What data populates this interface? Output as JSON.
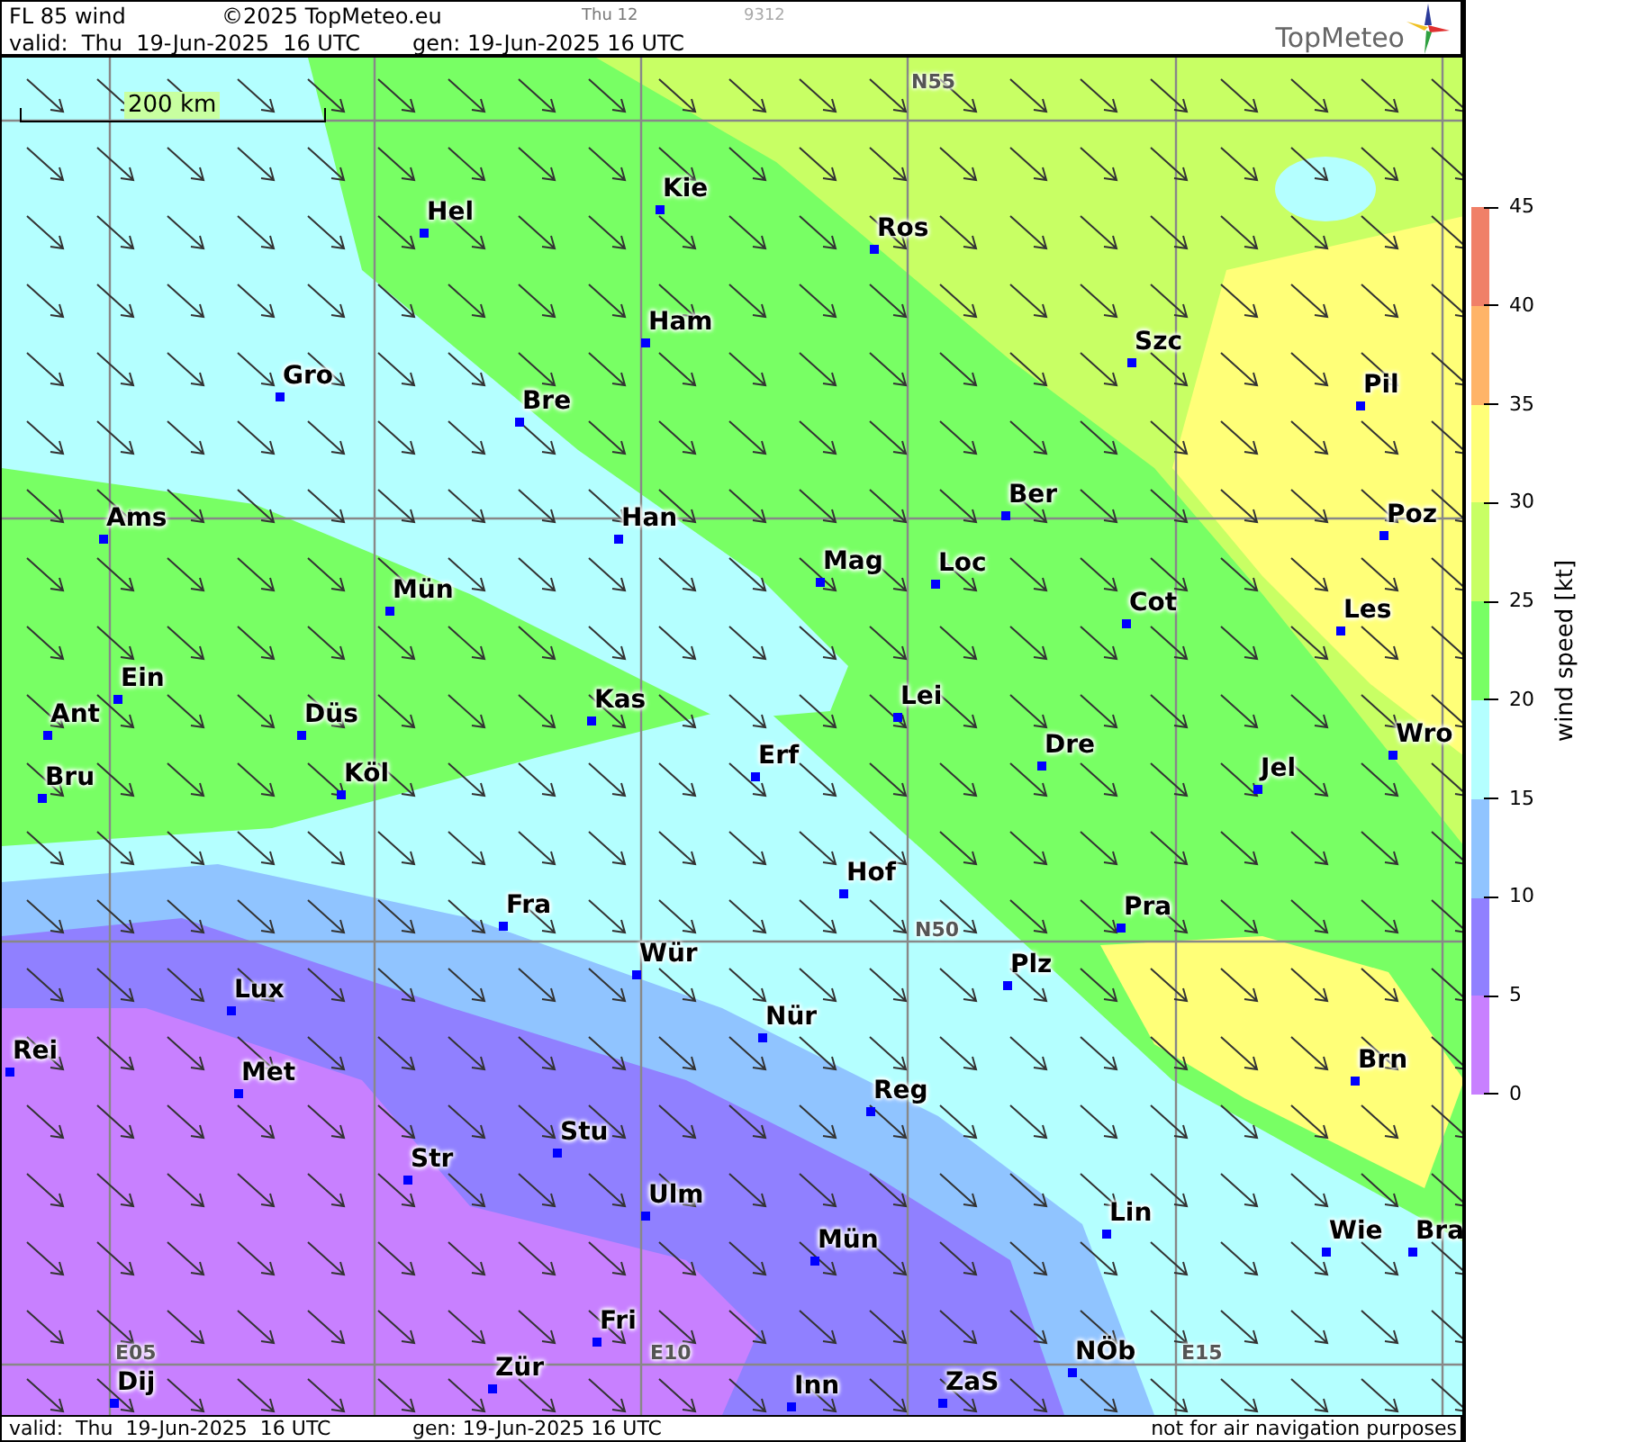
{
  "header": {
    "title": "FL 85 wind",
    "copyright": "©2025 TopMeteo.eu",
    "day": "Thu 12",
    "code": "9312",
    "valid": "valid:  Thu  19-Jun-2025  16 UTC",
    "gen": "gen: 19-Jun-2025 16 UTC",
    "logo": "TopMeteo"
  },
  "map": {
    "scale": "200 km",
    "grid_labels": [
      "N55",
      "N50",
      "E05",
      "E10",
      "E15"
    ],
    "cities": [
      {
        "name": "Hel"
      },
      {
        "name": "Kie"
      },
      {
        "name": "Ros"
      },
      {
        "name": "Ham"
      },
      {
        "name": "Szc"
      },
      {
        "name": "Gro"
      },
      {
        "name": "Bre"
      },
      {
        "name": "Pil"
      },
      {
        "name": "Ams"
      },
      {
        "name": "Han"
      },
      {
        "name": "Ber"
      },
      {
        "name": "Poz"
      },
      {
        "name": "Mag"
      },
      {
        "name": "Loc"
      },
      {
        "name": "Mün"
      },
      {
        "name": "Cot"
      },
      {
        "name": "Les"
      },
      {
        "name": "Ein"
      },
      {
        "name": "Kas"
      },
      {
        "name": "Lei"
      },
      {
        "name": "Ant"
      },
      {
        "name": "Düs"
      },
      {
        "name": "Dre"
      },
      {
        "name": "Wro"
      },
      {
        "name": "Erf"
      },
      {
        "name": "Bru"
      },
      {
        "name": "Köl"
      },
      {
        "name": "Jel"
      },
      {
        "name": "Hof"
      },
      {
        "name": "Fra"
      },
      {
        "name": "Pra"
      },
      {
        "name": "Wür"
      },
      {
        "name": "Plz"
      },
      {
        "name": "Lux"
      },
      {
        "name": "Nür"
      },
      {
        "name": "Rei"
      },
      {
        "name": "Met"
      },
      {
        "name": "Brn"
      },
      {
        "name": "Reg"
      },
      {
        "name": "Stu"
      },
      {
        "name": "Str"
      },
      {
        "name": "Ulm"
      },
      {
        "name": "Lin"
      },
      {
        "name": "Wie"
      },
      {
        "name": "Bra"
      },
      {
        "name": "Mün"
      },
      {
        "name": "Fri"
      },
      {
        "name": "NÖb"
      },
      {
        "name": "Dij"
      },
      {
        "name": "Zür"
      },
      {
        "name": "Inn"
      },
      {
        "name": "ZaS"
      }
    ]
  },
  "legend": {
    "title": "wind speed [kt]",
    "ticks": [
      "45",
      "40",
      "35",
      "30",
      "25",
      "20",
      "15",
      "10",
      "5",
      "0"
    ],
    "bands": [
      {
        "color": "#f08068"
      },
      {
        "color": "#ffb468"
      },
      {
        "color": "#ffff78"
      },
      {
        "color": "#c8ff64"
      },
      {
        "color": "#78ff64"
      },
      {
        "color": "#b4ffff"
      },
      {
        "color": "#90c4ff"
      },
      {
        "color": "#9080ff"
      },
      {
        "color": "#c880ff"
      }
    ]
  },
  "footer": {
    "valid": "valid:  Thu  19-Jun-2025  16 UTC",
    "gen": "gen: 19-Jun-2025 16 UTC",
    "note": "not for air navigation purposes"
  }
}
